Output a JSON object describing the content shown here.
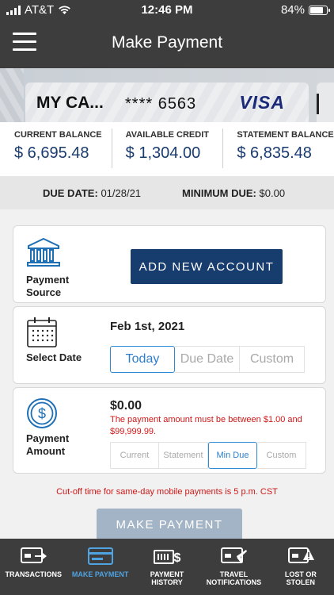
{
  "status_bar": {
    "carrier": "AT&T",
    "time": "12:46 PM",
    "battery": "84%",
    "battery_level": 0.84
  },
  "header": {
    "title": "Make Payment"
  },
  "card": {
    "name": "MY CA...",
    "number": "**** 6563",
    "brand": "VISA"
  },
  "balances": [
    {
      "label": "CURRENT BALANCE",
      "value": "$ 6,695.48"
    },
    {
      "label": "AVAILABLE CREDIT",
      "value": "$ 1,304.00"
    },
    {
      "label": "STATEMENT BALANCE",
      "value": "$ 6,835.48"
    }
  ],
  "due": {
    "due_date_label": "DUE DATE:",
    "due_date_value": "01/28/21",
    "min_due_label": "MINIMUM DUE:",
    "min_due_value": "$0.00"
  },
  "payment_source": {
    "label_line1": "Payment",
    "label_line2": "Source",
    "add_button": "ADD NEW ACCOUNT"
  },
  "select_date": {
    "label": "Select Date",
    "value": "Feb 1st, 2021",
    "options": [
      "Today",
      "Due Date",
      "Custom"
    ],
    "selected": "Today"
  },
  "payment_amount": {
    "label_line1": "Payment",
    "label_line2": "Amount",
    "value": "$0.00",
    "error": "The payment amount must be between $1.00 and $99,999.99.",
    "options": [
      "Current",
      "Statement",
      "Min Due",
      "Custom"
    ],
    "selected": "Min Due"
  },
  "cutoff_notice": "Cut-off time for same-day mobile payments is 5 p.m. CST",
  "make_payment_button": "MAKE PAYMENT",
  "bottom_nav": [
    {
      "line1": "TRANSACTIONS",
      "line2": "",
      "icon": "transactions-icon"
    },
    {
      "line1": "MAKE PAYMENT",
      "line2": "",
      "icon": "make-payment-icon"
    },
    {
      "line1": "PAYMENT",
      "line2": "HISTORY",
      "icon": "payment-history-icon"
    },
    {
      "line1": "TRAVEL",
      "line2": "NOTIFICATIONS",
      "icon": "travel-notifications-icon"
    },
    {
      "line1": "LOST OR",
      "line2": "STOLEN",
      "icon": "lost-or-stolen-icon"
    }
  ],
  "active_nav": "MAKE PAYMENT",
  "colors": {
    "header_bg": "#3d3d3d",
    "accent_navy": "#173c6e",
    "active_blue": "#2d8bd6",
    "error_red": "#d01818",
    "disabled_button": "#a3b4c6"
  }
}
